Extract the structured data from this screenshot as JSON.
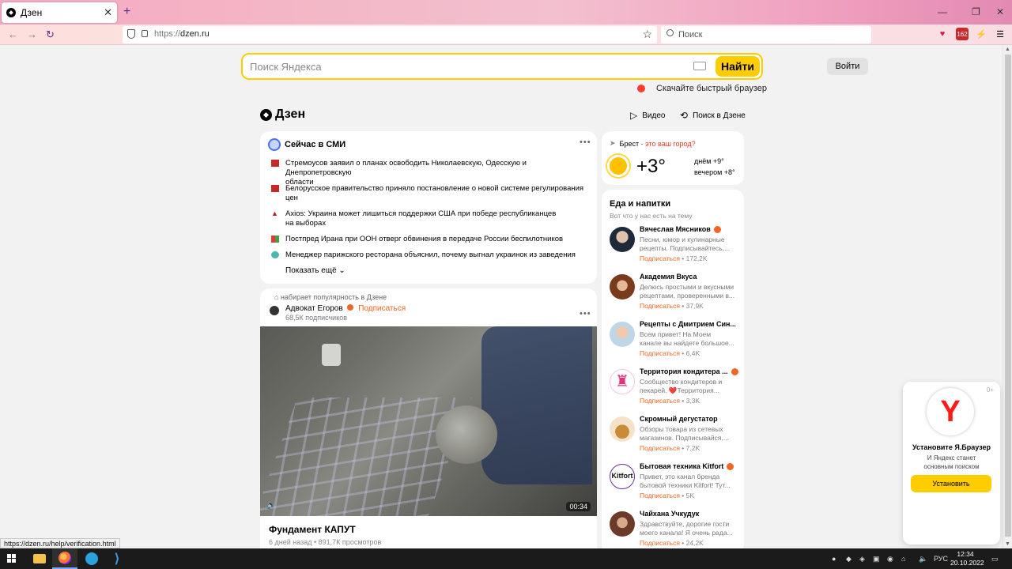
{
  "browser": {
    "tab_title": "Дзен",
    "url_scheme": "https://",
    "url_host": "dzen.ru",
    "search_placeholder": "Поиск",
    "ext_badge": "162",
    "status_url": "https://dzen.ru/help/verification.html"
  },
  "page": {
    "search_placeholder": "Поиск Яндекса",
    "search_button": "Найти",
    "login_button": "Войти",
    "download_browser": "Скачайте быстрый браузер",
    "logo_text": "Дзен",
    "video_link": "Видео",
    "dzen_search_link": "Поиск в Дзене"
  },
  "news": {
    "title": "Сейчас в СМИ",
    "items": [
      {
        "line1": "Стремоусов заявил о планах освободить Николаевскую, Одесскую и Днепропетровскую",
        "line2": "области"
      },
      {
        "line1": "Белорусское правительство приняло постановление о новой системе регулирования",
        "line2": "цен"
      },
      {
        "line1": "Axios: Украина может лишиться поддержки США при победе республиканцев",
        "line2": "на выборах"
      },
      {
        "line1": "Постпред Ирана при ООН отверг обвинения в передаче России беспилотников",
        "line2": ""
      },
      {
        "line1": "Менеджер парижского ресторана объяснил, почему выгнал украинок из заведения",
        "line2": ""
      }
    ],
    "show_more": "Показать ещё"
  },
  "post": {
    "trending": "набирает популярность в Дзене",
    "author": "Адвокат Егоров",
    "subscribe": "Подписаться",
    "subscribers": "68,5К подписчиков",
    "duration": "00:34",
    "title": "Фундамент КАПУТ",
    "meta": "6 дней назад • 891,7К просмотров"
  },
  "weather": {
    "city": "Брест",
    "question": "это ваш город?",
    "temp": "+3°",
    "day": "днём +9°",
    "evening": "вечером +8°"
  },
  "food": {
    "title": "Еда и напитки",
    "subtitle": "Вот что у нас есть на тему",
    "subscribe_label": "Подписаться",
    "channels": [
      {
        "name": "Вячеслав Мясников",
        "verified": true,
        "desc1": "Песни, юмор и кулинарные",
        "desc2": "рецепты. Подписывайтесь,...",
        "count": "172,2K"
      },
      {
        "name": "Академия Вкуса",
        "verified": false,
        "desc1": "Делюсь простыми и вкусными",
        "desc2": "рецептами, проверенными в...",
        "count": "37,9K"
      },
      {
        "name": "Рецепты с Дмитрием Син...",
        "verified": false,
        "desc1": "Всем привет! На Моем",
        "desc2": "канале вы найдете большое...",
        "count": "6,4K"
      },
      {
        "name": "Территория кондитера ...",
        "verified": true,
        "desc1": "Сообщество кондитеров и",
        "desc2": "пекарей. ❤️Территория...",
        "count": "3,3K"
      },
      {
        "name": "Скромный дегустатор",
        "verified": false,
        "desc1": "Обзоры товара из сетевых",
        "desc2": "магазинов. Подписывайся,...",
        "count": "7,2K"
      },
      {
        "name": "Бытовая техника Kitfort",
        "verified": true,
        "desc1": "Привет, это канал бренда",
        "desc2": "бытовой техники Kitfort! Тут...",
        "count": "5K"
      },
      {
        "name": "Чайхана Учкудук",
        "verified": false,
        "desc1": "Здравствуйте, дорогие гости",
        "desc2": "моего канала! Я очень рада...",
        "count": "24,2K"
      }
    ]
  },
  "promo": {
    "title": "Установите Я.Браузер",
    "desc1": "И Яндекс станет",
    "desc2": "основным поиском",
    "button": "Установить",
    "close": "0+"
  },
  "taskbar": {
    "lang": "РУС",
    "time": "12:34",
    "date": "20.10.2022"
  },
  "colors": {
    "accent_yellow": "#ffcc00",
    "accent_orange": "#f26522",
    "link_red": "#e63a27"
  }
}
